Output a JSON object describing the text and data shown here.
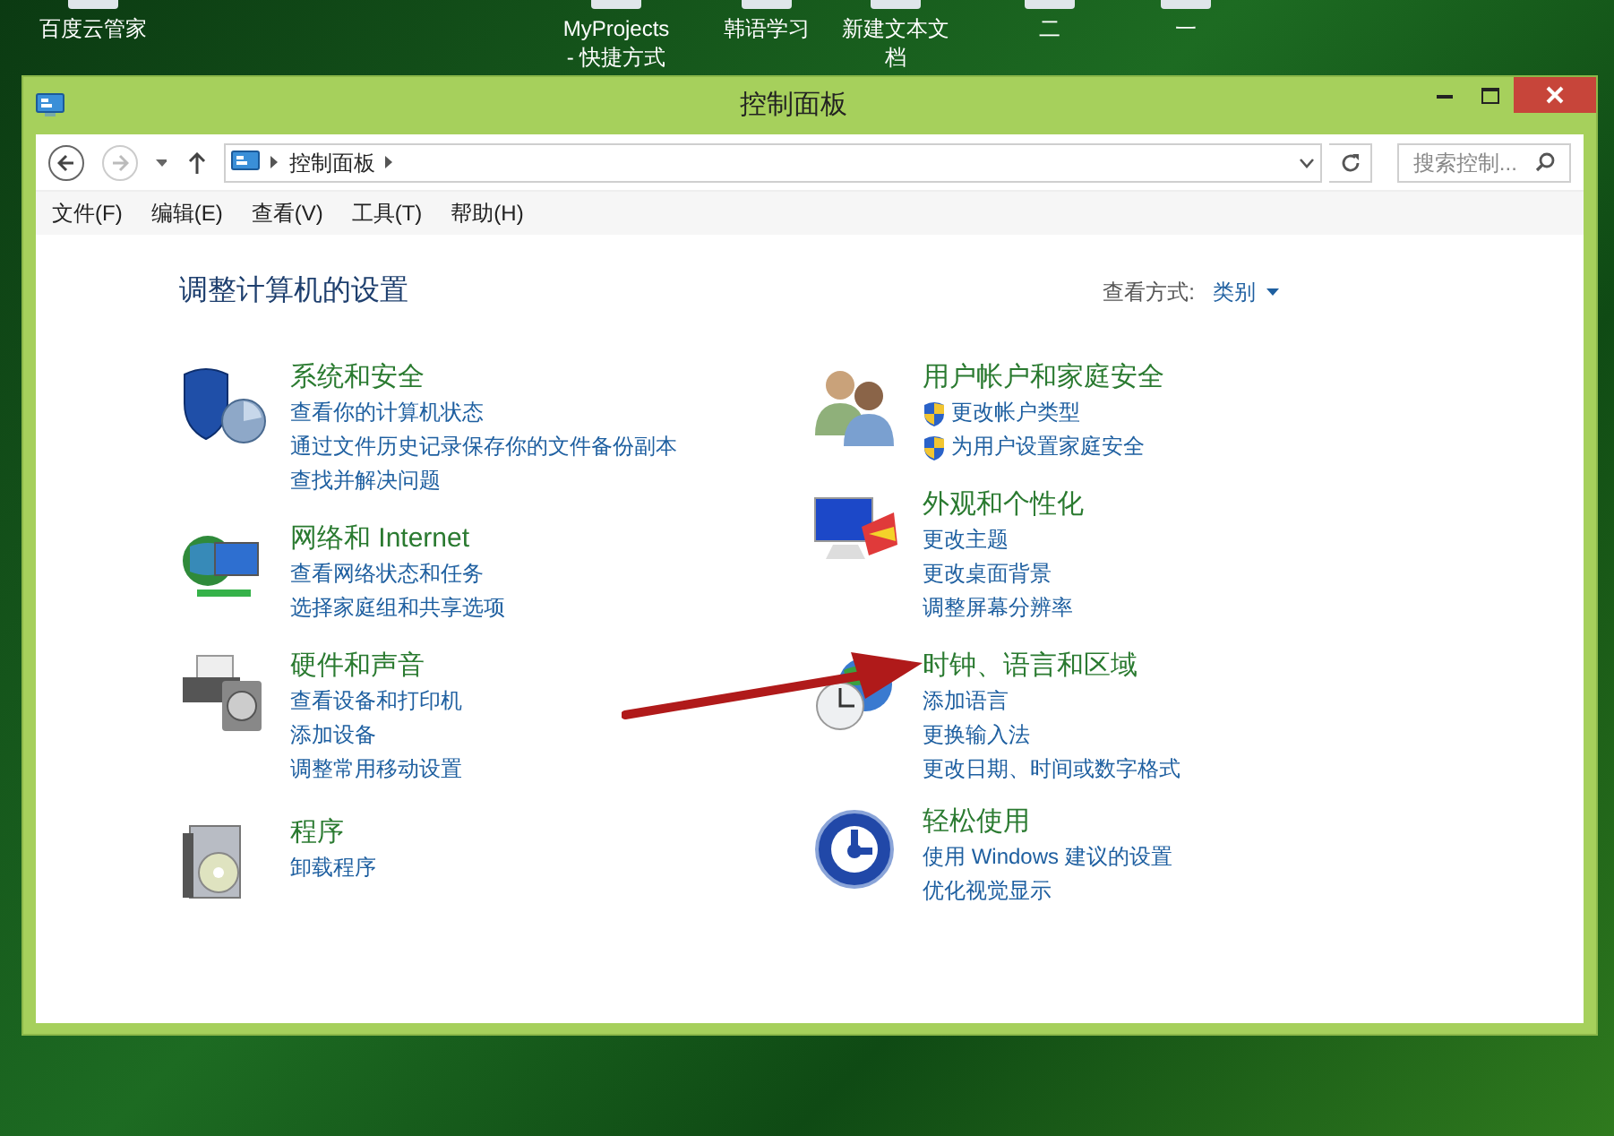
{
  "desktop_icons": [
    {
      "label": "百度云管家"
    },
    {
      "label": "MyProjects - 快捷方式"
    },
    {
      "label": "韩语学习"
    },
    {
      "label": "新建文本文档"
    },
    {
      "label": "二"
    },
    {
      "label": "一"
    }
  ],
  "window": {
    "title": "控制面板"
  },
  "address_bar": {
    "path": "控制面板",
    "search_placeholder": "搜索控制..."
  },
  "menu": [
    "文件(F)",
    "编辑(E)",
    "查看(V)",
    "工具(T)",
    "帮助(H)"
  ],
  "heading": "调整计算机的设置",
  "view_by": {
    "label": "查看方式:",
    "value": "类别"
  },
  "columns": [
    {
      "categories": [
        {
          "title": "系统和安全",
          "links": [
            {
              "text": "查看你的计算机状态",
              "shield": false
            },
            {
              "text": "通过文件历史记录保存你的文件备份副本",
              "shield": false
            },
            {
              "text": "查找并解决问题",
              "shield": false
            }
          ]
        },
        {
          "title": "网络和 Internet",
          "links": [
            {
              "text": "查看网络状态和任务",
              "shield": false
            },
            {
              "text": "选择家庭组和共享选项",
              "shield": false
            }
          ]
        },
        {
          "title": "硬件和声音",
          "links": [
            {
              "text": "查看设备和打印机",
              "shield": false
            },
            {
              "text": "添加设备",
              "shield": false
            },
            {
              "text": "调整常用移动设置",
              "shield": false
            }
          ]
        },
        {
          "title": "程序",
          "links": [
            {
              "text": "卸载程序",
              "shield": false
            }
          ]
        }
      ]
    },
    {
      "categories": [
        {
          "title": "用户帐户和家庭安全",
          "links": [
            {
              "text": "更改帐户类型",
              "shield": true
            },
            {
              "text": "为用户设置家庭安全",
              "shield": true
            }
          ]
        },
        {
          "title": "外观和个性化",
          "links": [
            {
              "text": "更改主题",
              "shield": false
            },
            {
              "text": "更改桌面背景",
              "shield": false
            },
            {
              "text": "调整屏幕分辨率",
              "shield": false
            }
          ]
        },
        {
          "title": "时钟、语言和区域",
          "links": [
            {
              "text": "添加语言",
              "shield": false
            },
            {
              "text": "更换输入法",
              "shield": false
            },
            {
              "text": "更改日期、时间或数字格式",
              "shield": false
            }
          ]
        },
        {
          "title": "轻松使用",
          "links": [
            {
              "text": "使用 Windows 建议的设置",
              "shield": false
            },
            {
              "text": "优化视觉显示",
              "shield": false
            }
          ]
        }
      ]
    }
  ]
}
